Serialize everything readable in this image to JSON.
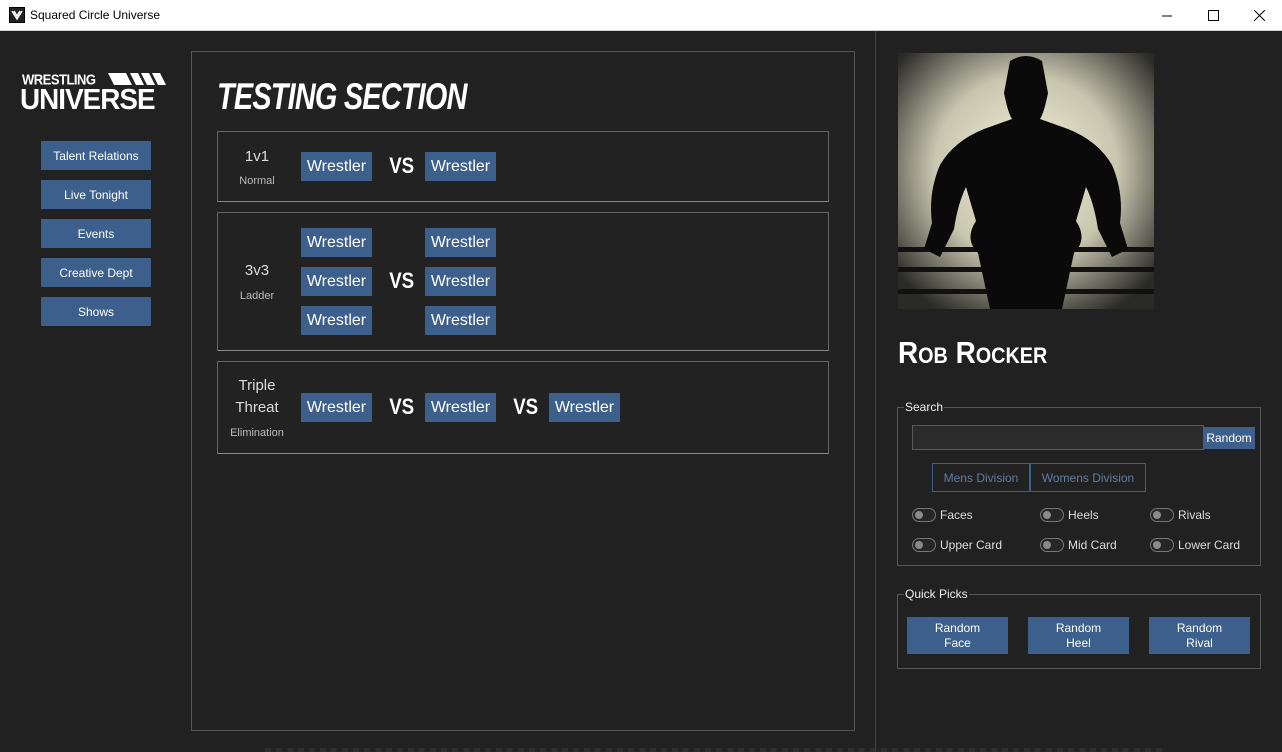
{
  "window": {
    "title": "Squared Circle Universe"
  },
  "logo": {
    "top": "WRESTLING",
    "bottom": "UNIVERSE"
  },
  "sidebar": {
    "items": [
      {
        "label": "Talent Relations"
      },
      {
        "label": "Live Tonight"
      },
      {
        "label": "Events"
      },
      {
        "label": "Creative Dept"
      },
      {
        "label": "Shows"
      }
    ]
  },
  "main": {
    "title": "TESTING SECTION",
    "vs_label": "VS",
    "wrestler_label": "Wrestler",
    "matches": [
      {
        "name": "1v1",
        "type": "Normal"
      },
      {
        "name": "3v3",
        "type": "Ladder"
      },
      {
        "name": "Triple\nThreat",
        "type": "Elimination"
      }
    ]
  },
  "profile": {
    "name": "Rob Rocker",
    "image": "wrestler-silhouette"
  },
  "search": {
    "group_label": "Search",
    "value": "",
    "random_label": "Random",
    "divisions": [
      {
        "label": "Mens Division"
      },
      {
        "label": "Womens Division"
      }
    ],
    "filters": [
      {
        "label": "Faces",
        "on": false
      },
      {
        "label": "Heels",
        "on": false
      },
      {
        "label": "Rivals",
        "on": false
      },
      {
        "label": "Upper Card",
        "on": false
      },
      {
        "label": "Mid Card",
        "on": false
      },
      {
        "label": "Lower Card",
        "on": false
      }
    ]
  },
  "quick_picks": {
    "group_label": "Quick Picks",
    "buttons": [
      {
        "label": "Random\nFace"
      },
      {
        "label": "Random\nHeel"
      },
      {
        "label": "Random\nRival"
      }
    ]
  },
  "colors": {
    "background": "#212121",
    "button": "#3d5f8c",
    "outline_button_text": "#5e7ea5"
  }
}
